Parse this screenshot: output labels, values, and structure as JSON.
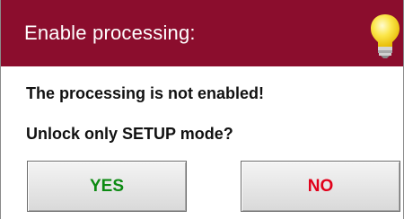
{
  "dialog": {
    "title": "Enable processing:",
    "icon": "lightbulb-icon",
    "message": "The processing is not enabled!",
    "question": "Unlock only SETUP mode?",
    "yes_label": "YES",
    "no_label": "NO"
  },
  "colors": {
    "titlebar": "#8b0d2d",
    "yes_text": "#0c8a12",
    "no_text": "#e1001a",
    "bulb": "#f7d51e"
  }
}
